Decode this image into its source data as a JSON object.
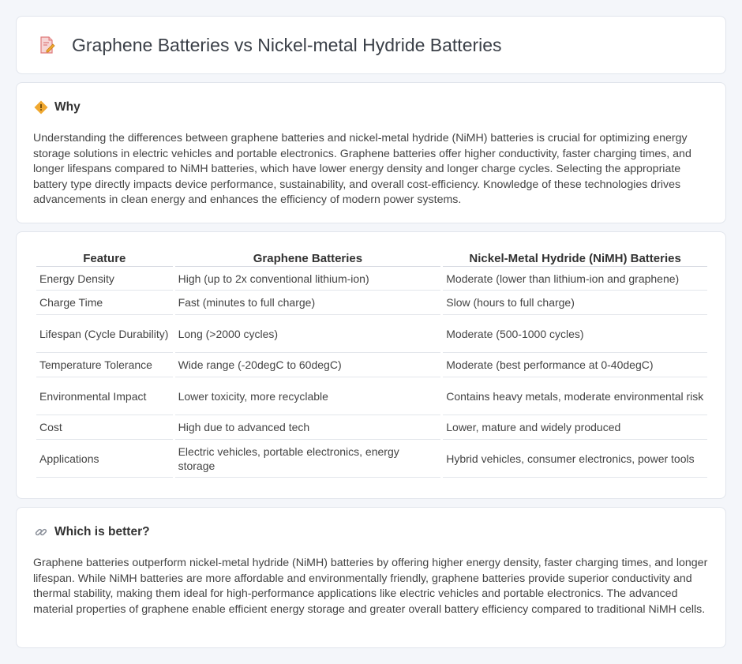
{
  "page": {
    "title": "Graphene Batteries vs Nickel-metal Hydride Batteries",
    "title_icon": "document-pencil-icon"
  },
  "why": {
    "heading": "Why",
    "icon": "diamond-warning-icon",
    "body": "Understanding the differences between graphene batteries and nickel-metal hydride (NiMH) batteries is crucial for optimizing energy storage solutions in electric vehicles and portable electronics. Graphene batteries offer higher conductivity, faster charging times, and longer lifespans compared to NiMH batteries, which have lower energy density and longer charge cycles. Selecting the appropriate battery type directly impacts device performance, sustainability, and overall cost-efficiency. Knowledge of these technologies drives advancements in clean energy and enhances the efficiency of modern power systems."
  },
  "table": {
    "headers": [
      "Feature",
      "Graphene Batteries",
      "Nickel-Metal Hydride (NiMH) Batteries"
    ],
    "rows": [
      [
        "Energy Density",
        "High (up to 2x conventional lithium-ion)",
        "Moderate (lower than lithium-ion and graphene)"
      ],
      [
        "Charge Time",
        "Fast (minutes to full charge)",
        "Slow (hours to full charge)"
      ],
      [
        "Lifespan (Cycle Durability)",
        "Long (>2000 cycles)",
        "Moderate (500-1000 cycles)"
      ],
      [
        "Temperature Tolerance",
        "Wide range (-20degC to 60degC)",
        "Moderate (best performance at 0-40degC)"
      ],
      [
        "Environmental Impact",
        "Lower toxicity, more recyclable",
        "Contains heavy metals, moderate environmental risk"
      ],
      [
        "Cost",
        "High due to advanced tech",
        "Lower, mature and widely produced"
      ],
      [
        "Applications",
        "Electric vehicles, portable electronics, energy storage",
        "Hybrid vehicles, consumer electronics, power tools"
      ]
    ]
  },
  "better": {
    "heading": "Which is better?",
    "icon": "link-icon",
    "body": "Graphene batteries outperform nickel-metal hydride (NiMH) batteries by offering higher energy density, faster charging times, and longer lifespan. While NiMH batteries are more affordable and environmentally friendly, graphene batteries provide superior conductivity and thermal stability, making them ideal for high-performance applications like electric vehicles and portable electronics. The advanced material properties of graphene enable efficient energy storage and greater overall battery efficiency compared to traditional NiMH cells."
  },
  "colors": {
    "background": "#f4f6fa",
    "card_border": "#e1e5ec",
    "accent_orange": "#f0a830",
    "icon_pink": "#e07070"
  }
}
